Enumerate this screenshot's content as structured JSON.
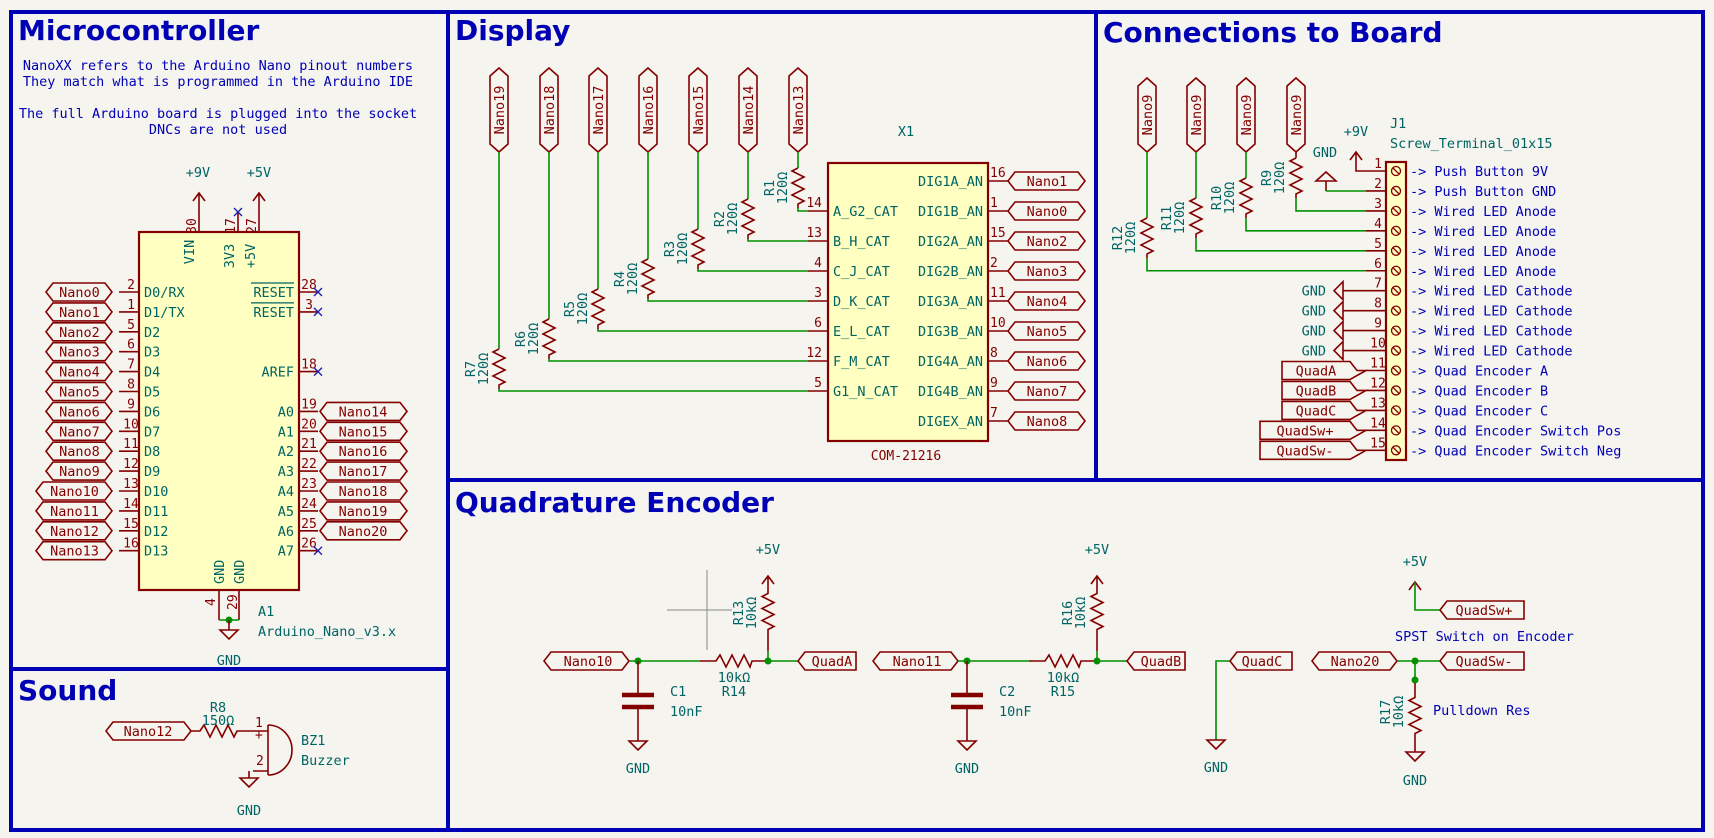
{
  "sections": {
    "microcontroller": "Microcontroller",
    "display": "Display",
    "connections": "Connections to Board",
    "sound": "Sound",
    "encoder": "Quadrature Encoder"
  },
  "notes": {
    "mcu_line1": "NanoXX refers to the Arduino Nano pinout numbers",
    "mcu_line2": "They match what is programmed in the Arduino IDE",
    "mcu_line3": "The full Arduino board is plugged into the socket",
    "mcu_line4": "DNCs are not used",
    "spst": "SPST Switch on Encoder",
    "pulldown": "Pulldown Res"
  },
  "power": {
    "v9": "+9V",
    "v5": "+5V",
    "gnd": "GND"
  },
  "arduino": {
    "ref": "A1",
    "value": "Arduino_Nano_v3.x",
    "top_pins": [
      {
        "num": "30",
        "name": "VIN"
      },
      {
        "num": "17",
        "name": "3V3"
      },
      {
        "num": "27",
        "name": "+5V"
      }
    ],
    "bottom_pins": [
      {
        "num": "4",
        "name": "GND"
      },
      {
        "num": "29",
        "name": "GND"
      }
    ],
    "left_pins": [
      {
        "num": "2",
        "name": "D0/RX",
        "net": "Nano0"
      },
      {
        "num": "1",
        "name": "D1/TX",
        "net": "Nano1"
      },
      {
        "num": "5",
        "name": "D2",
        "net": "Nano2"
      },
      {
        "num": "6",
        "name": "D3",
        "net": "Nano3"
      },
      {
        "num": "7",
        "name": "D4",
        "net": "Nano4"
      },
      {
        "num": "8",
        "name": "D5",
        "net": "Nano5"
      },
      {
        "num": "9",
        "name": "D6",
        "net": "Nano6"
      },
      {
        "num": "10",
        "name": "D7",
        "net": "Nano7"
      },
      {
        "num": "11",
        "name": "D8",
        "net": "Nano8"
      },
      {
        "num": "12",
        "name": "D9",
        "net": "Nano9"
      },
      {
        "num": "13",
        "name": "D10",
        "net": "Nano10"
      },
      {
        "num": "14",
        "name": "D11",
        "net": "Nano11"
      },
      {
        "num": "15",
        "name": "D12",
        "net": "Nano12"
      },
      {
        "num": "16",
        "name": "D13",
        "net": "Nano13"
      }
    ],
    "right_pins": [
      {
        "num": "28",
        "name": "RESET",
        "net": "",
        "nc": true,
        "row": 0
      },
      {
        "num": "3",
        "name": "RESET",
        "net": "",
        "nc": true,
        "row": 1
      },
      {
        "num": "18",
        "name": "AREF",
        "net": "",
        "nc": true,
        "row": 4
      },
      {
        "num": "19",
        "name": "A0",
        "net": "Nano14",
        "nc": false,
        "row": 6
      },
      {
        "num": "20",
        "name": "A1",
        "net": "Nano15",
        "nc": false,
        "row": 7
      },
      {
        "num": "21",
        "name": "A2",
        "net": "Nano16",
        "nc": false,
        "row": 8
      },
      {
        "num": "22",
        "name": "A3",
        "net": "Nano17",
        "nc": false,
        "row": 9
      },
      {
        "num": "23",
        "name": "A4",
        "net": "Nano18",
        "nc": false,
        "row": 10
      },
      {
        "num": "24",
        "name": "A5",
        "net": "Nano19",
        "nc": false,
        "row": 11
      },
      {
        "num": "25",
        "name": "A6",
        "net": "Nano20",
        "nc": false,
        "row": 12
      },
      {
        "num": "26",
        "name": "A7",
        "net": "",
        "nc": true,
        "row": 13
      }
    ]
  },
  "display": {
    "ref": "X1",
    "value": "COM-21216",
    "top_nets": [
      "Nano19",
      "Nano18",
      "Nano17",
      "Nano16",
      "Nano15",
      "Nano14",
      "Nano13"
    ],
    "resistors": [
      {
        "ref": "R7",
        "value": "120Ω"
      },
      {
        "ref": "R6",
        "value": "120Ω"
      },
      {
        "ref": "R5",
        "value": "120Ω"
      },
      {
        "ref": "R4",
        "value": "120Ω"
      },
      {
        "ref": "R3",
        "value": "120Ω"
      },
      {
        "ref": "R2",
        "value": "120Ω"
      },
      {
        "ref": "R1",
        "value": "120Ω"
      }
    ],
    "left_pins": [
      {
        "num": "14",
        "name": "A_G2_CAT"
      },
      {
        "num": "13",
        "name": "B_H_CAT"
      },
      {
        "num": "4",
        "name": "C_J_CAT"
      },
      {
        "num": "3",
        "name": "D_K_CAT"
      },
      {
        "num": "6",
        "name": "E_L_CAT"
      },
      {
        "num": "12",
        "name": "F_M_CAT"
      },
      {
        "num": "5",
        "name": "G1_N_CAT"
      }
    ],
    "right_pins": [
      {
        "num": "16",
        "name": "DIG1A_AN",
        "net": "Nano1"
      },
      {
        "num": "1",
        "name": "DIG1B_AN",
        "net": "Nano0"
      },
      {
        "num": "15",
        "name": "DIG2A_AN",
        "net": "Nano2"
      },
      {
        "num": "2",
        "name": "DIG2B_AN",
        "net": "Nano3"
      },
      {
        "num": "11",
        "name": "DIG3A_AN",
        "net": "Nano4"
      },
      {
        "num": "10",
        "name": "DIG3B_AN",
        "net": "Nano5"
      },
      {
        "num": "8",
        "name": "DIG4A_AN",
        "net": "Nano6"
      },
      {
        "num": "9",
        "name": "DIG4B_AN",
        "net": "Nano7"
      },
      {
        "num": "7",
        "name": "DIGEX_AN",
        "net": "Nano8"
      }
    ]
  },
  "connector": {
    "ref": "J1",
    "value": "Screw_Terminal_01x15",
    "top_nets": [
      "Nano9",
      "Nano9",
      "Nano9",
      "Nano9"
    ],
    "resistors": [
      {
        "ref": "R12",
        "value": "120Ω"
      },
      {
        "ref": "R11",
        "value": "120Ω"
      },
      {
        "ref": "R10",
        "value": "120Ω"
      },
      {
        "ref": "R9",
        "value": "120Ω"
      }
    ],
    "pins": [
      {
        "num": "1",
        "desc": "-> Push Button 9V",
        "src": ""
      },
      {
        "num": "2",
        "desc": "-> Push Button GND",
        "src": ""
      },
      {
        "num": "3",
        "desc": "-> Wired LED Anode",
        "src": ""
      },
      {
        "num": "4",
        "desc": "-> Wired LED Anode",
        "src": ""
      },
      {
        "num": "5",
        "desc": "-> Wired LED Anode",
        "src": ""
      },
      {
        "num": "6",
        "desc": "-> Wired LED Anode",
        "src": ""
      },
      {
        "num": "7",
        "desc": "-> Wired LED Cathode",
        "src": "GND"
      },
      {
        "num": "8",
        "desc": "-> Wired LED Cathode",
        "src": "GND"
      },
      {
        "num": "9",
        "desc": "-> Wired LED Cathode",
        "src": "GND"
      },
      {
        "num": "10",
        "desc": "-> Wired LED Cathode",
        "src": "GND"
      },
      {
        "num": "11",
        "desc": "-> Quad Encoder A",
        "src": "QuadA"
      },
      {
        "num": "12",
        "desc": "-> Quad Encoder B",
        "src": "QuadB"
      },
      {
        "num": "13",
        "desc": "-> Quad Encoder C",
        "src": "QuadC"
      },
      {
        "num": "14",
        "desc": "-> Quad Encoder Switch Pos",
        "src": "QuadSw+"
      },
      {
        "num": "15",
        "desc": "-> Quad Encoder Switch Neg",
        "src": "QuadSw-"
      }
    ]
  },
  "sound": {
    "net": "Nano12",
    "r_ref": "R8",
    "r_value": "150Ω",
    "bz_ref": "BZ1",
    "bz_value": "Buzzer",
    "pin1": "1",
    "pin2": "2",
    "plus": "+"
  },
  "encoder": {
    "chA": {
      "net": "Nano10",
      "c_ref": "C1",
      "c_value": "10nF",
      "rs_ref": "R14",
      "rs_value": "10kΩ",
      "rp_ref": "R13",
      "rp_value": "10kΩ",
      "out": "QuadA"
    },
    "chB": {
      "net": "Nano11",
      "c_ref": "C2",
      "c_value": "10nF",
      "rs_ref": "R15",
      "rs_value": "10kΩ",
      "rp_ref": "R16",
      "rp_value": "10kΩ",
      "out": "QuadB"
    },
    "chC": {
      "out": "QuadC"
    },
    "sw": {
      "plus": "QuadSw+",
      "minus": "QuadSw-",
      "net": "Nano20",
      "r_ref": "R17",
      "r_value": "10kΩ"
    }
  }
}
